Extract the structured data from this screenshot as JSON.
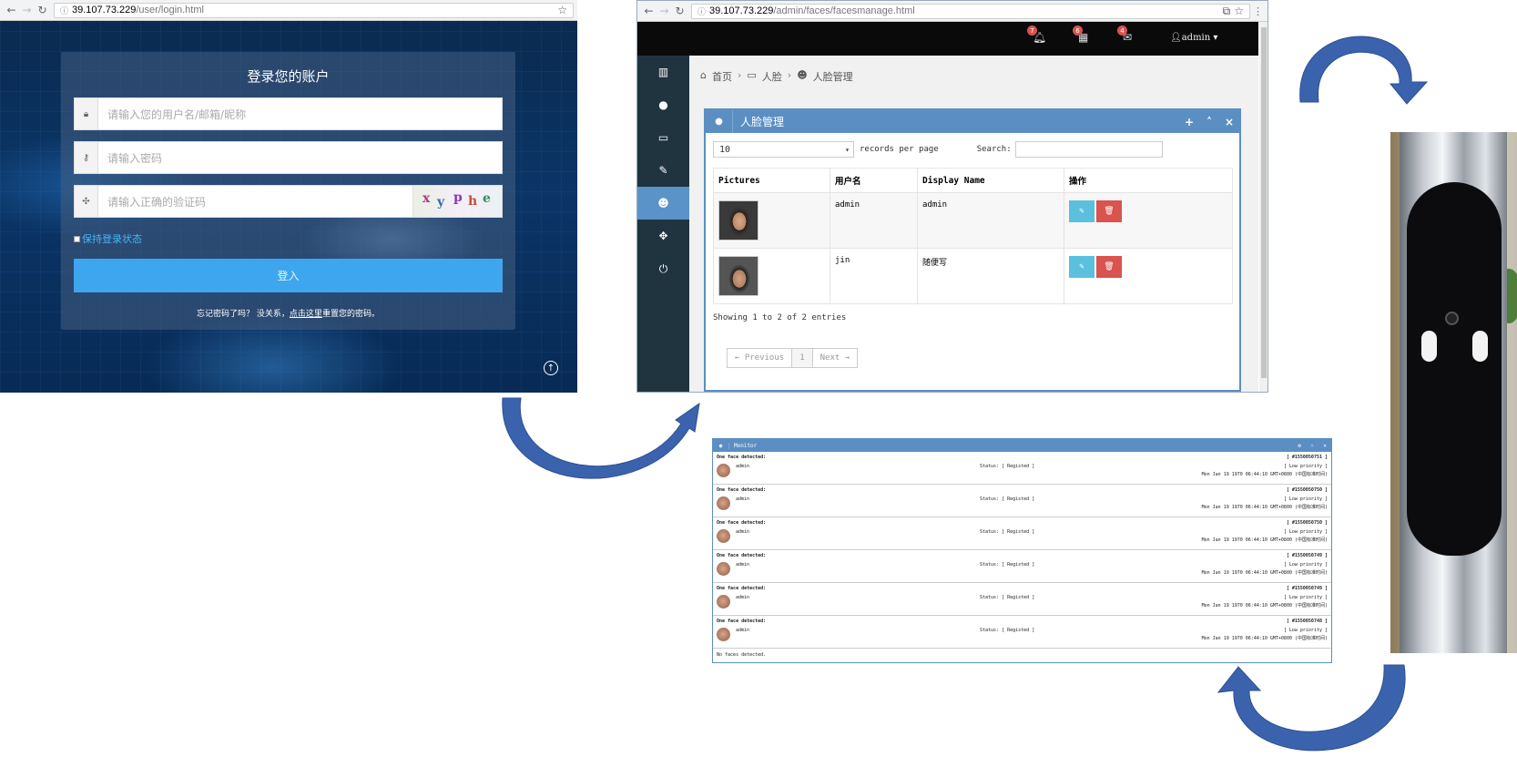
{
  "login_window": {
    "url_host": "39.107.73.229",
    "url_path": "/user/login.html",
    "title": "登录您的账户",
    "username_placeholder": "请输入您的用户名/邮箱/昵称",
    "password_placeholder": "请输入密码",
    "captcha_placeholder": "请输入正确的验证码",
    "captcha_text": "xyphe",
    "remember_label": "保持登录状态",
    "login_button": "登入",
    "forgot_prefix": "忘记密码了吗？ 没关系，",
    "forgot_link": "点击这里",
    "forgot_suffix": "重置您的密码。"
  },
  "admin_window": {
    "url_host": "39.107.73.229",
    "url_path": "/admin/faces/facesmanage.html",
    "badges": {
      "alerts": "7",
      "calendar": "6",
      "messages": "4"
    },
    "user_menu": "admin",
    "breadcrumb": [
      "首页",
      "人脸",
      "人脸管理"
    ],
    "box_title": "人脸管理",
    "records_value": "10",
    "records_label": "records per page",
    "search_label": "Search:",
    "columns": [
      "Pictures",
      "用户名",
      "Display Name",
      "操作"
    ],
    "rows": [
      {
        "username": "admin",
        "display_name": "admin"
      },
      {
        "username": "jin",
        "display_name": "随便写"
      }
    ],
    "info": "Showing 1 to 2 of 2 entries",
    "pager": {
      "prev": "← Previous",
      "page": "1",
      "next": "Next →"
    }
  },
  "monitor": {
    "title": "Monitor",
    "entries": [
      {
        "headline": "One face detected:",
        "id": "[ #1550050751 ]",
        "name": "admin",
        "status": "Status: [ Registed ]",
        "priority": "[ Low priority ]",
        "time": "Mon Jan 19 1970 06:44:10 GMT+0800 (中国标准时间)"
      },
      {
        "headline": "One face detected:",
        "id": "[ #1550050750 ]",
        "name": "admin",
        "status": "Status: [ Registed ]",
        "priority": "[ Low priority ]",
        "time": "Mon Jan 19 1970 06:44:10 GMT+0800 (中国标准时间)"
      },
      {
        "headline": "One face detected:",
        "id": "[ #1550050750 ]",
        "name": "admin",
        "status": "Status: [ Registed ]",
        "priority": "[ Low priority ]",
        "time": "Mon Jan 19 1970 06:44:10 GMT+0800 (中国标准时间)"
      },
      {
        "headline": "One face detected:",
        "id": "[ #1550050749 ]",
        "name": "admin",
        "status": "Status: [ Registed ]",
        "priority": "[ Low priority ]",
        "time": "Mon Jan 19 1970 06:44:10 GMT+0800 (中国标准时间)"
      },
      {
        "headline": "One face detected:",
        "id": "[ #1550050749 ]",
        "name": "admin",
        "status": "Status: [ Registed ]",
        "priority": "[ Low priority ]",
        "time": "Mon Jan 19 1970 06:44:10 GMT+0800 (中国标准时间)"
      },
      {
        "headline": "One face detected:",
        "id": "[ #1550050748 ]",
        "name": "admin",
        "status": "Status: [ Registed ]",
        "priority": "[ Low priority ]",
        "time": "Mon Jan 19 1970 06:44:10 GMT+0800 (中国标准时间)"
      }
    ],
    "footer": "No faces detected."
  },
  "colors": {
    "arrow": "#3b63ad",
    "primary": "#3ea6ee",
    "box_header": "#5b8ec3",
    "danger": "#d9534f",
    "info": "#5bc0de"
  }
}
